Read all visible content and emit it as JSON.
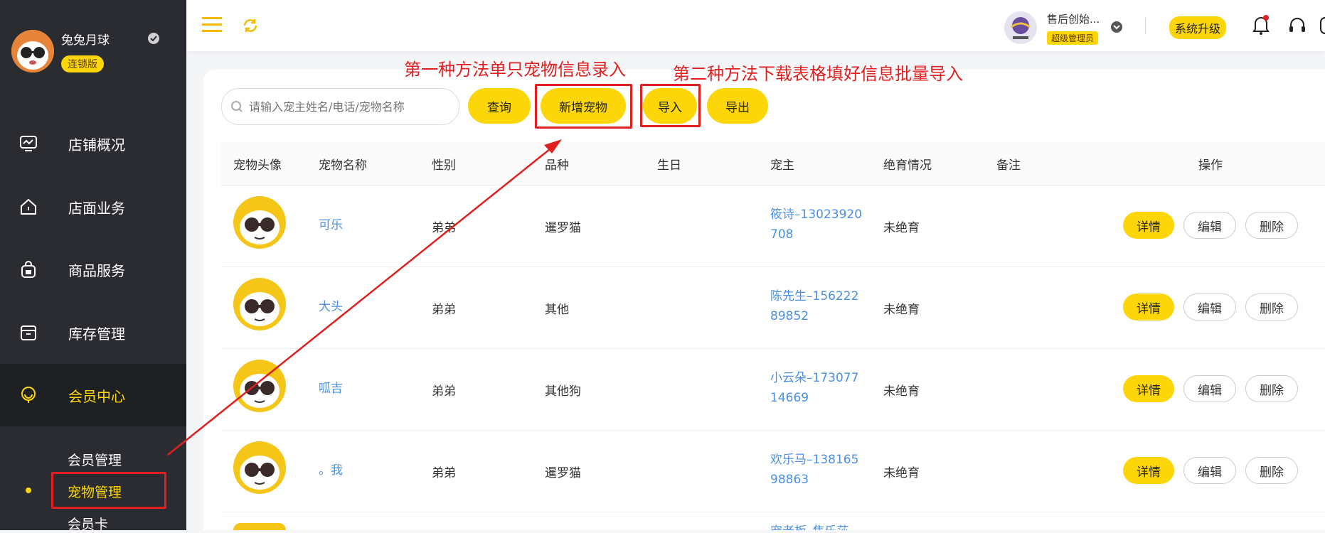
{
  "sidebar": {
    "store_name": "兔兔月球",
    "store_badge": "连锁版",
    "nav": [
      "店铺概况",
      "店面业务",
      "商品服务",
      "库存管理",
      "会员中心"
    ],
    "sub": [
      "会员管理",
      "宠物管理",
      "会员卡"
    ]
  },
  "topbar": {
    "user_name": "售后创始...",
    "user_role": "超级管理员",
    "upgrade": "系统升级"
  },
  "toolbar": {
    "search_placeholder": "请输入宠主姓名/电话/宠物名称",
    "query": "查询",
    "add": "新增宠物",
    "import": "导入",
    "export": "导出"
  },
  "annotations": {
    "first": "第一种方法单只宠物信息录入",
    "second": "第二种方法下载表格填好信息批量导入"
  },
  "table": {
    "headers": [
      "宠物头像",
      "宠物名称",
      "性别",
      "品种",
      "生日",
      "宠主",
      "绝育情况",
      "备注",
      "操作"
    ],
    "rows": [
      {
        "name": "可乐",
        "gender": "弟弟",
        "breed": "暹罗猫",
        "owner1": "筱诗–13023920",
        "owner2": "708",
        "neuter": "未绝育"
      },
      {
        "name": "大头",
        "gender": "弟弟",
        "breed": "其他",
        "owner1": "陈先生–156222",
        "owner2": "89852",
        "neuter": "未绝育"
      },
      {
        "name": "呱吉",
        "gender": "弟弟",
        "breed": "其他狗",
        "owner1": "小云朵–173077",
        "owner2": "14669",
        "neuter": "未绝育"
      },
      {
        "name": "。我",
        "gender": "弟弟",
        "breed": "暹罗猫",
        "owner1": "欢乐马–138165",
        "owner2": "98863",
        "neuter": "未绝育"
      },
      {
        "owner1": "宠老板–焦乐莎"
      }
    ],
    "actions": {
      "detail": "详情",
      "edit": "编辑",
      "delete": "删除"
    }
  },
  "colors": {
    "accent": "#fdd60a",
    "sidebar": "#2b2c32",
    "annotation": "#e02020",
    "link": "#4a90e2"
  }
}
